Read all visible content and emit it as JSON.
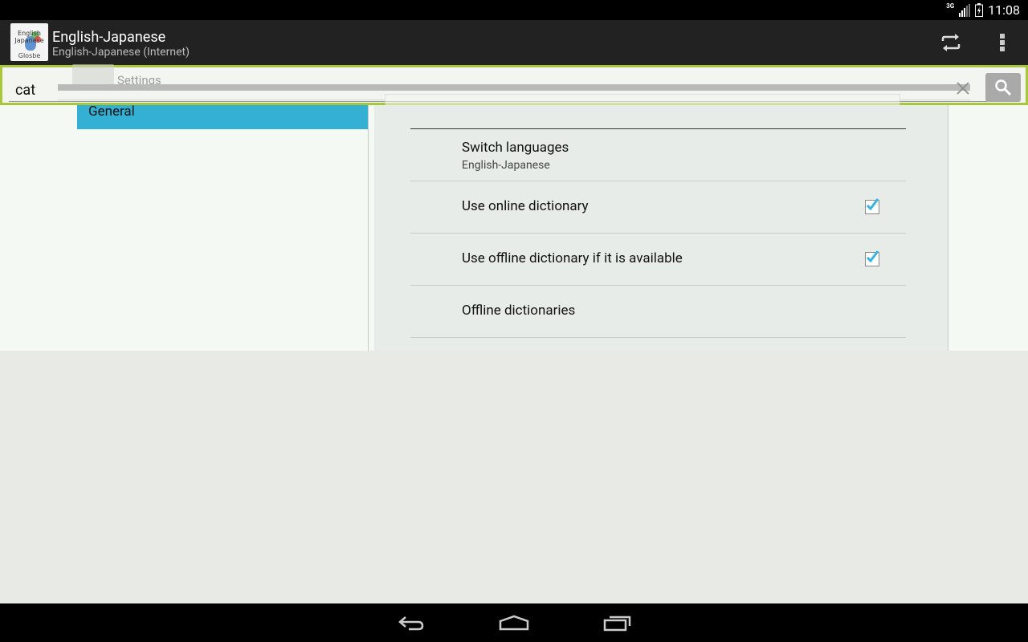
{
  "status_bar": {
    "network": "3G",
    "time": "11:08"
  },
  "app": {
    "logo_text_top": "English Japanese",
    "logo_text_bottom": "Glosbe",
    "title": "English-Japanese",
    "subtitle": "English-Japanese (Internet)"
  },
  "search": {
    "value": "cat"
  },
  "overlay": {
    "title": "Settings"
  },
  "settings": {
    "header": "General",
    "items": [
      {
        "title": "Switch languages",
        "summary": "English-Japanese"
      },
      {
        "title": "Use online dictionary",
        "checked": true
      },
      {
        "title": "Use offline dictionary if it is available",
        "checked": true
      },
      {
        "title": "Offline dictionaries"
      }
    ]
  },
  "colors": {
    "accent": "#33b0d4",
    "searchbar": "#a8c63a",
    "actionbar": "#222222",
    "checkmark": "#33b5e5"
  }
}
